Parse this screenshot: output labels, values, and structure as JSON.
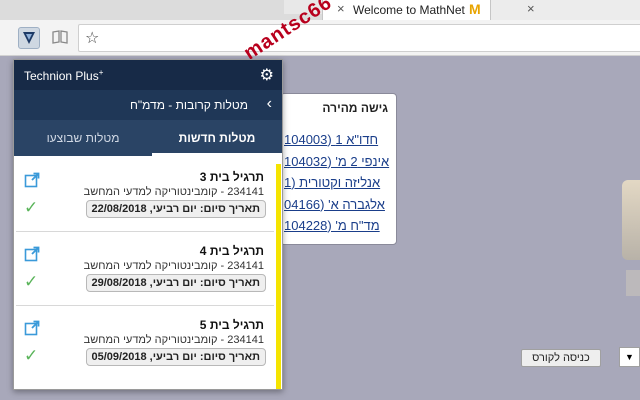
{
  "browser": {
    "active_tab_title": "Welcome to MathNet",
    "active_tab_favicon": "M",
    "close_glyph": "×",
    "star_icon": "☆"
  },
  "watermark": "mantsc66",
  "page": {
    "quick_access": {
      "title": "גישה מהירה",
      "links": [
        "חדו\"א 1 (104003",
        "אינפי 2 מ' (104032",
        "אנליזה וקטורית (1",
        "אלגברה א' (04166",
        "מד\"ח מ' (104228"
      ]
    },
    "enter_course_button": "כניסה לקורס",
    "dropdown_arrow": "▼"
  },
  "popup": {
    "brand": "Technion Plus",
    "brand_sup": "+",
    "gear_icon": "⚙",
    "back_icon": "‹",
    "course_header": "מטלות קרובות - מדמ\"ח",
    "tabs": {
      "new": "מטלות חדשות",
      "done": "מטלות שבוצעו"
    },
    "assignments": [
      {
        "title": "תרגיל בית 3",
        "course": "234141 - קומבינטוריקה למדעי המחשב",
        "due": "תאריך סיום: יום רביעי, 22/08/2018"
      },
      {
        "title": "תרגיל בית 4",
        "course": "234141 - קומבינטוריקה למדעי המחשב",
        "due": "תאריך סיום: יום רביעי, 29/08/2018"
      },
      {
        "title": "תרגיל בית 5",
        "course": "234141 - קומבינטוריקה למדעי המחשב",
        "due": "תאריך סיום: יום רביעי, 05/09/2018"
      }
    ],
    "check_glyph": "✓"
  }
}
